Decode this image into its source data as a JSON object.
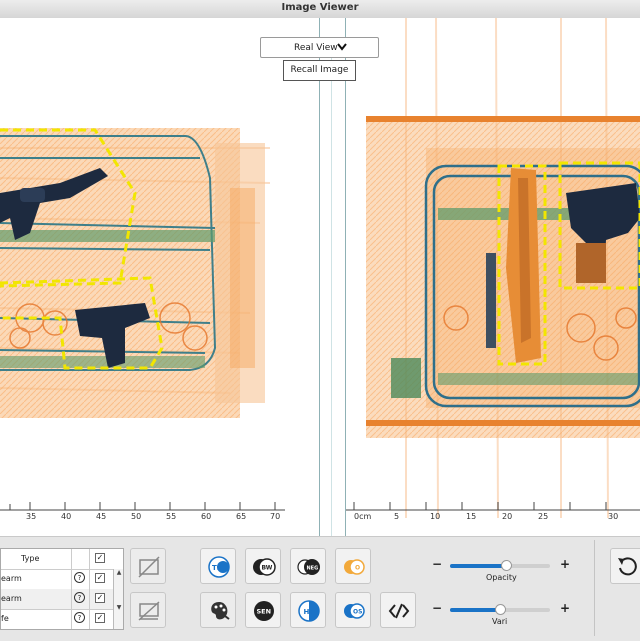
{
  "window": {
    "title": "Image Viewer"
  },
  "view_selector": {
    "value": "Real View"
  },
  "recall_button": {
    "label": "Recall Image"
  },
  "ruler_left": {
    "labels": [
      "35",
      "40",
      "45",
      "50",
      "55",
      "60",
      "65",
      "70"
    ]
  },
  "ruler_right": {
    "labels": [
      "0cm",
      "5",
      "10",
      "15",
      "20",
      "25",
      "30"
    ]
  },
  "table": {
    "header": {
      "type": "Type"
    },
    "rows": [
      {
        "label": "earm",
        "help": "?",
        "checked": "✓"
      },
      {
        "label": "earm",
        "help": "?",
        "checked": "✓"
      },
      {
        "label": "fe",
        "help": "?",
        "checked": "✓"
      }
    ],
    "header_checked": "✓"
  },
  "tool_buttons": {
    "ts": "TS",
    "bw": "BW",
    "neg": "NEG",
    "o": "O",
    "sen": "SEN",
    "hi": "HI",
    "os": "OS"
  },
  "sliders": {
    "opacity": {
      "label": "Opacity",
      "value": 0.56,
      "minus": "−",
      "plus": "+"
    },
    "vari": {
      "label": "Vari",
      "value": 0.5,
      "minus": "−",
      "plus": "+"
    }
  },
  "colors": {
    "accent": "#1a73c7",
    "xray_orange": "#f28a2e",
    "xray_green": "#4c8a5a",
    "box_yellow": "#f2e600"
  }
}
